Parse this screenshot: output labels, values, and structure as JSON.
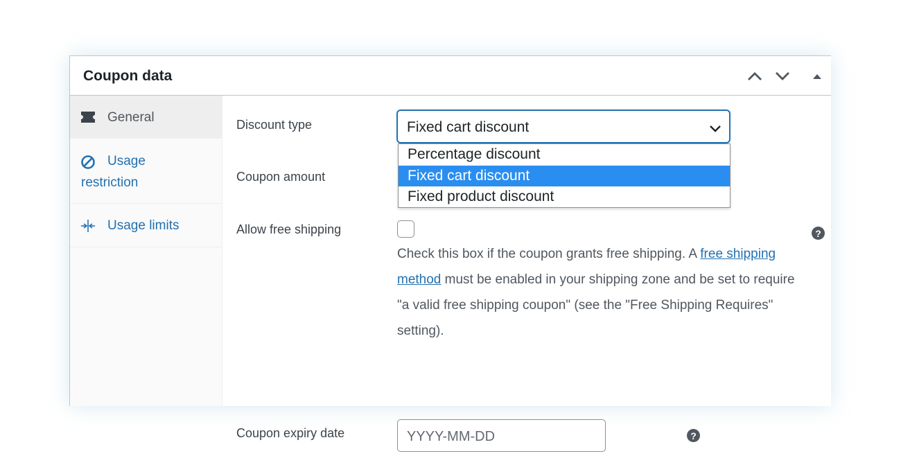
{
  "panel": {
    "title": "Coupon data"
  },
  "header_controls": {
    "move_up_icon": "chevron-up-icon",
    "move_down_icon": "chevron-down-icon",
    "toggle_icon": "triangle-up-icon"
  },
  "tabs": [
    {
      "label": "General",
      "icon": "ticket-icon",
      "active": true
    },
    {
      "label_line1": "Usage",
      "label_line2": "restriction",
      "icon": "no-entry-icon",
      "active": false
    },
    {
      "label": "Usage limits",
      "icon": "collapse-arrows-icon",
      "active": false
    }
  ],
  "fields": {
    "discount_type": {
      "label": "Discount type",
      "value": "Fixed cart discount",
      "options": [
        "Percentage discount",
        "Fixed cart discount",
        "Fixed product discount"
      ],
      "highlighted_option": "Fixed cart discount"
    },
    "coupon_amount": {
      "label": "Coupon amount"
    },
    "free_shipping": {
      "label": "Allow free shipping",
      "checked": false,
      "desc_before": "Check this box if the coupon grants free shipping. A ",
      "desc_link": "free shipping method",
      "desc_after": " must be enabled in your shipping zone and be set to require \"a valid free shipping coupon\" (see the \"Free Shipping Requires\" setting)."
    },
    "expiry_date": {
      "label": "Coupon expiry date",
      "placeholder": "YYYY-MM-DD"
    }
  },
  "help_glyph": "?",
  "colors": {
    "accent": "#2271b1",
    "highlight": "#2a8ef0",
    "border": "#c3c4c7",
    "text": "#1d2327",
    "muted": "#50575e"
  }
}
